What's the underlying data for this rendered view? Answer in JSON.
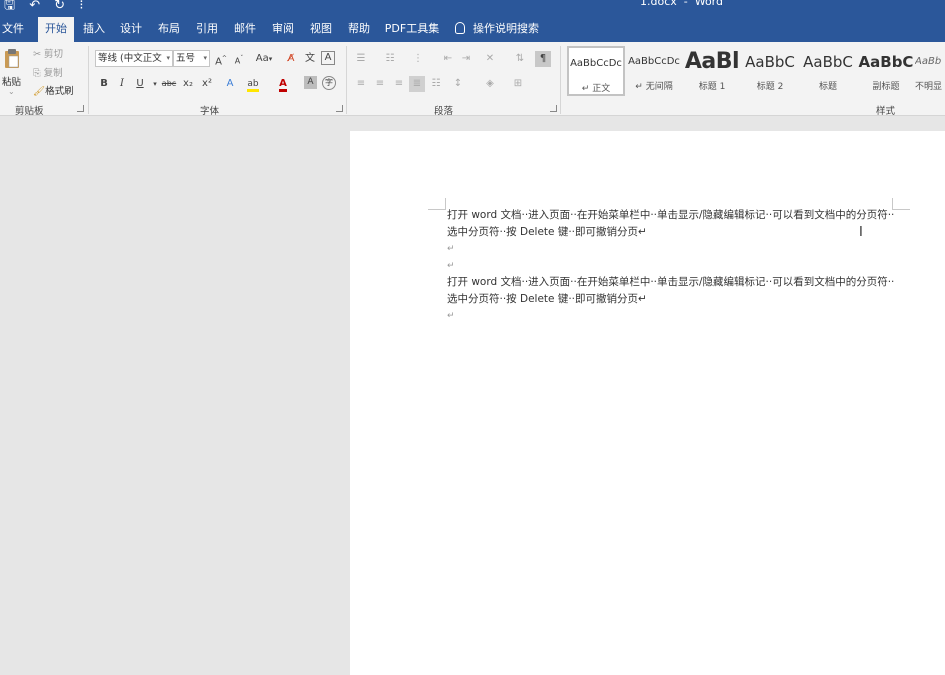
{
  "titlebar": {
    "title": "1.docx  -  Word",
    "qat": {
      "save_icon": "save-icon",
      "undo_icon": "undo-icon",
      "redo_icon": "redo-icon",
      "customize_icon": "more-icon"
    }
  },
  "tabs": [
    {
      "label": "文件",
      "active": false
    },
    {
      "label": "开始",
      "active": true
    },
    {
      "label": "插入",
      "active": false
    },
    {
      "label": "设计",
      "active": false
    },
    {
      "label": "布局",
      "active": false
    },
    {
      "label": "引用",
      "active": false
    },
    {
      "label": "邮件",
      "active": false
    },
    {
      "label": "审阅",
      "active": false
    },
    {
      "label": "视图",
      "active": false
    },
    {
      "label": "帮助",
      "active": false
    },
    {
      "label": "PDF工具集",
      "active": false
    }
  ],
  "tell_me": {
    "label": "操作说明搜索",
    "icon": "lightbulb-icon"
  },
  "ribbon": {
    "clipboard": {
      "label": "剪贴板",
      "paste": "粘贴",
      "cut": "剪切",
      "copy": "复制",
      "format_painter": "格式刷"
    },
    "font": {
      "label": "字体",
      "font_name": "等线 (中文正文",
      "font_size": "五号",
      "bold": "B",
      "italic": "I",
      "underline": "U",
      "strikethrough": "abc",
      "subscript": "x₂",
      "superscript": "x²",
      "grow": "A",
      "shrink": "A",
      "change_case": "Aa",
      "font_color_letter": "A",
      "highlight_letter": "ab"
    },
    "paragraph": {
      "label": "段落"
    },
    "styles": {
      "label": "样式",
      "items": [
        {
          "preview": "AaBbCcDc",
          "name": "↵ 正文",
          "kind": "small",
          "selected": true
        },
        {
          "preview": "AaBbCcDc",
          "name": "↵ 无间隔",
          "kind": "small",
          "selected": false
        },
        {
          "preview": "AaBl",
          "name": "标题 1",
          "kind": "big",
          "selected": false
        },
        {
          "preview": "AaBbC",
          "name": "标题 2",
          "kind": "mid",
          "selected": false
        },
        {
          "preview": "AaBbC",
          "name": "标题",
          "kind": "mid",
          "selected": false
        },
        {
          "preview": "AaBbC",
          "name": "副标题",
          "kind": "midb",
          "selected": false
        },
        {
          "preview": "AaBb",
          "name": "不明显",
          "kind": "ital",
          "selected": false
        }
      ]
    }
  },
  "document": {
    "paragraphs": [
      {
        "text": "打开 word 文档··进入页面··在开始菜单栏中··单击显示/隐藏编辑标记··可以看到文档中的分页符··选中分页符··按 Delete 键··即可撤销分页↵",
        "kind": "text"
      },
      {
        "text": "↵",
        "kind": "mark"
      },
      {
        "text": "↵",
        "kind": "mark"
      },
      {
        "text": "打开 word 文档··进入页面··在开始菜单栏中··单击显示/隐藏编辑标记··可以看到文档中的分页符··选中分页符··按 Delete 键··即可撤销分页↵",
        "kind": "text"
      },
      {
        "text": "↵",
        "kind": "mark"
      }
    ]
  },
  "colors": {
    "accent": "#2b579a",
    "ribbon_bg": "#f3f3f3",
    "canvas_bg": "#e6e6e6",
    "page_bg": "#ffffff"
  }
}
